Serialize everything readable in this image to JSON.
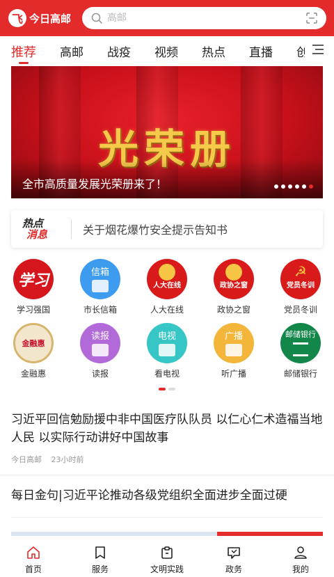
{
  "header": {
    "logo_mark": "飞",
    "app_name": "今日高邮",
    "search_placeholder": "高邮"
  },
  "tabs": [
    {
      "label": "推荐",
      "active": true
    },
    {
      "label": "高邮"
    },
    {
      "label": "战疫"
    },
    {
      "label": "视频"
    },
    {
      "label": "热点"
    },
    {
      "label": "直播"
    },
    {
      "label": "创"
    }
  ],
  "banner": {
    "title": "光荣册",
    "caption": "全市高质量发展光荣册来了！",
    "slide_count": 6,
    "active_slide": 6
  },
  "notice": {
    "badge_line1": "热点",
    "badge_line2": "消息",
    "text": "关于烟花爆竹安全提示告知书"
  },
  "services": [
    {
      "label": "学习强国",
      "icon": "xuexi-icon",
      "inner": "学习",
      "color": "#d6161d"
    },
    {
      "label": "市长信箱",
      "icon": "mayor-mailbox-icon",
      "inner": "信箱",
      "color": "#3d9cf0"
    },
    {
      "label": "人大在线",
      "icon": "npc-online-icon",
      "inner": "人大在线",
      "color": "#d81a1a"
    },
    {
      "label": "政协之窗",
      "icon": "cppcc-window-icon",
      "inner": "政协之窗",
      "color": "#d81a1a"
    },
    {
      "label": "党员冬训",
      "icon": "party-training-icon",
      "inner": "党员冬训",
      "color": "#d81a1a"
    },
    {
      "label": "金融惠",
      "icon": "finance-icon",
      "inner": "金融惠",
      "color": "#f2e6cc"
    },
    {
      "label": "读报",
      "icon": "newspaper-icon",
      "inner": "读报",
      "color": "#b26ad9"
    },
    {
      "label": "看电视",
      "icon": "tv-icon",
      "inner": "电视",
      "color": "#36c6c6"
    },
    {
      "label": "听广播",
      "icon": "radio-icon",
      "inner": "广播",
      "color": "#f3b63a"
    },
    {
      "label": "邮储银行",
      "icon": "postal-bank-icon",
      "inner": "邮储银行",
      "color": "#13874a"
    }
  ],
  "services_pager": {
    "pages": 2,
    "active": 1
  },
  "news": [
    {
      "title": "习近平回信勉励援中非中国医疗队队员 以仁心仁术造福当地人民 以实际行动讲好中国故事",
      "source": "今日高邮",
      "time": "23小时前"
    },
    {
      "title": "每日金句|习近平论推动各级党组织全面进步全面过硬"
    }
  ],
  "scroll_progress": 0.34,
  "bottom_nav": [
    {
      "label": "首页",
      "icon": "home-icon",
      "active": true
    },
    {
      "label": "服务",
      "icon": "bookmark-icon"
    },
    {
      "label": "文明实践",
      "icon": "clipboard-icon"
    },
    {
      "label": "政务",
      "icon": "government-icon"
    },
    {
      "label": "我的",
      "icon": "user-icon"
    }
  ],
  "colors": {
    "accent": "#e32b2b",
    "gold": "#f5c94a"
  }
}
